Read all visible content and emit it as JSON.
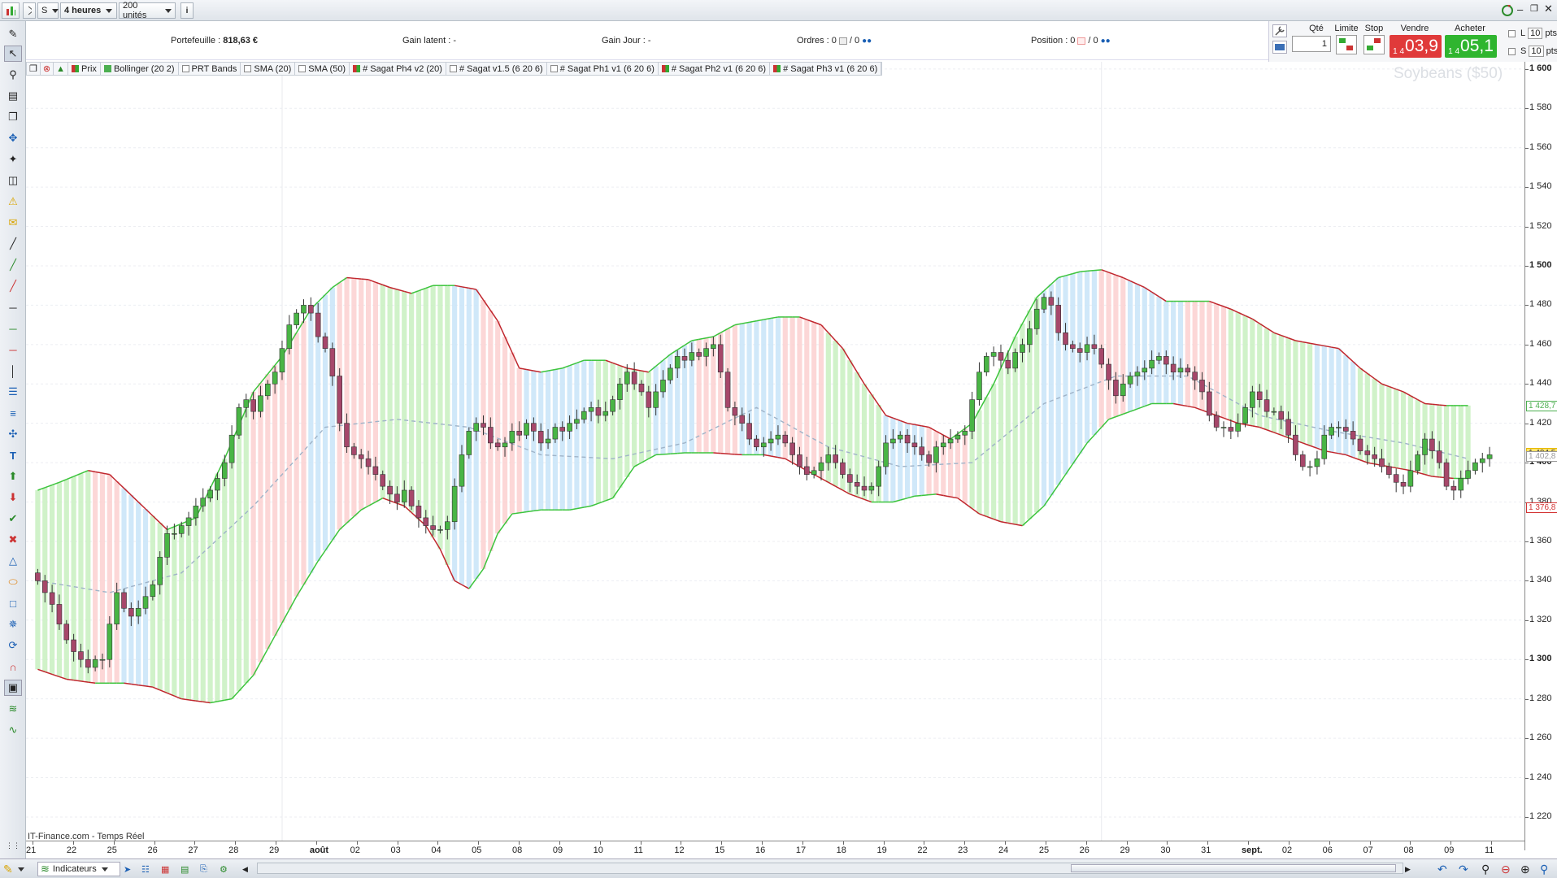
{
  "toolbar": {
    "symbol": "S",
    "timeframe": "4 heures",
    "units": "200 unités",
    "info_icon": "i"
  },
  "info": {
    "portfolio_label": "Portefeuille :",
    "portfolio_value": "818,63 €",
    "latent_label": "Gain latent :",
    "latent_value": "-",
    "day_label": "Gain Jour :",
    "day_value": "-",
    "orders_label": "Ordres :",
    "orders_a": "0",
    "orders_b": "/ 0",
    "position_label": "Position :",
    "position_a": "0",
    "position_b": "/ 0"
  },
  "order": {
    "qty_label": "Qté",
    "qty_value": "1",
    "limit_label": "Limite",
    "stop_label": "Stop",
    "sell_label": "Vendre",
    "buy_label": "Acheter",
    "sell_small": "1 4",
    "sell_big": "03,9",
    "buy_small": "1 4",
    "buy_big": "05,1",
    "l_label": "L",
    "s_label": "S",
    "pts_value": "10",
    "pts_label": "pts"
  },
  "legend": [
    "Prix",
    "Bollinger (20 2)",
    "PRT Bands",
    "SMA (20)",
    "SMA (50)",
    "# Sagat Ph4 v2 (20)",
    "# Sagat v1.5 (6 20 6)",
    "# Sagat Ph1 v1 (6 20 6)",
    "# Sagat Ph2 v1 (6 20 6)",
    "# Sagat Ph3 v1 (6 20 6)"
  ],
  "instrument": "Soybeans ($50)",
  "source": "IT-Finance.com - Temps Réel",
  "bottom": {
    "indicators_label": "Indicateurs"
  },
  "chart_data": {
    "type": "candlestick",
    "y_ticks": [
      "1 600",
      "1 580",
      "1 560",
      "1 540",
      "1 520",
      "1 500",
      "1 480",
      "1 460",
      "1 440",
      "1 420",
      "1 400",
      "1 380",
      "1 360",
      "1 340",
      "1 320",
      "1 300",
      "1 280",
      "1 260",
      "1 240",
      "1 220"
    ],
    "ylim": [
      1208,
      1602
    ],
    "x_ticks": [
      "21",
      "22",
      "25",
      "26",
      "27",
      "28",
      "29",
      "août",
      "02",
      "03",
      "04",
      "05",
      "08",
      "09",
      "10",
      "11",
      "12",
      "15",
      "16",
      "17",
      "18",
      "19",
      "22",
      "23",
      "24",
      "25",
      "26",
      "29",
      "30",
      "31",
      "sept.",
      "02",
      "06",
      "07",
      "08",
      "09",
      "11"
    ],
    "price_labels": [
      {
        "text": "1 428,7",
        "value": 1428.7,
        "color": "#4caf50"
      },
      {
        "text": "1 404,5",
        "value": 1404.5,
        "color": "#e6b800"
      },
      {
        "text": "1 402,8",
        "value": 1402.8,
        "color": "#999999"
      },
      {
        "text": "1 376,8",
        "value": 1376.8,
        "color": "#d33333"
      }
    ],
    "bands": {
      "upper": [
        [
          0,
          1386
        ],
        [
          3,
          1390
        ],
        [
          7,
          1396
        ],
        [
          10,
          1394
        ],
        [
          14,
          1380
        ],
        [
          18,
          1366
        ],
        [
          22,
          1372
        ],
        [
          26,
          1402
        ],
        [
          30,
          1436
        ],
        [
          34,
          1454
        ],
        [
          38,
          1478
        ],
        [
          41,
          1489
        ],
        [
          43,
          1494
        ],
        [
          46,
          1493
        ],
        [
          49,
          1489
        ],
        [
          52,
          1486
        ],
        [
          55,
          1490
        ],
        [
          58,
          1490
        ],
        [
          61,
          1488
        ],
        [
          64,
          1472
        ],
        [
          67,
          1448
        ],
        [
          70,
          1446
        ],
        [
          73,
          1448
        ],
        [
          76,
          1452
        ],
        [
          79,
          1452
        ],
        [
          82,
          1448
        ],
        [
          85,
          1446
        ],
        [
          88,
          1455
        ],
        [
          91,
          1462
        ],
        [
          94,
          1464
        ],
        [
          97,
          1470
        ],
        [
          100,
          1472
        ],
        [
          103,
          1474
        ],
        [
          106,
          1474
        ],
        [
          109,
          1470
        ],
        [
          112,
          1458
        ],
        [
          115,
          1440
        ],
        [
          118,
          1424
        ],
        [
          121,
          1420
        ],
        [
          124,
          1418
        ],
        [
          127,
          1412
        ],
        [
          130,
          1420
        ],
        [
          133,
          1440
        ],
        [
          136,
          1464
        ],
        [
          139,
          1484
        ],
        [
          142,
          1494
        ],
        [
          145,
          1497
        ],
        [
          148,
          1498
        ],
        [
          151,
          1494
        ],
        [
          154,
          1489
        ],
        [
          157,
          1482
        ],
        [
          160,
          1482
        ],
        [
          163,
          1482
        ],
        [
          166,
          1478
        ],
        [
          169,
          1473
        ],
        [
          172,
          1466
        ],
        [
          175,
          1462
        ],
        [
          178,
          1460
        ],
        [
          181,
          1458
        ],
        [
          184,
          1448
        ],
        [
          187,
          1440
        ],
        [
          190,
          1436
        ],
        [
          193,
          1430
        ],
        [
          196,
          1429
        ],
        [
          199,
          1429
        ]
      ],
      "middle": [
        [
          0,
          1340
        ],
        [
          10,
          1334
        ],
        [
          20,
          1344
        ],
        [
          30,
          1378
        ],
        [
          40,
          1418
        ],
        [
          50,
          1422
        ],
        [
          60,
          1418
        ],
        [
          70,
          1404
        ],
        [
          80,
          1402
        ],
        [
          90,
          1410
        ],
        [
          100,
          1428
        ],
        [
          110,
          1408
        ],
        [
          120,
          1398
        ],
        [
          130,
          1400
        ],
        [
          140,
          1430
        ],
        [
          150,
          1444
        ],
        [
          160,
          1444
        ],
        [
          170,
          1424
        ],
        [
          180,
          1416
        ],
        [
          190,
          1410
        ],
        [
          199,
          1402
        ]
      ],
      "lower": [
        [
          0,
          1295
        ],
        [
          4,
          1290
        ],
        [
          8,
          1288
        ],
        [
          12,
          1288
        ],
        [
          16,
          1286
        ],
        [
          20,
          1280
        ],
        [
          24,
          1278
        ],
        [
          27,
          1280
        ],
        [
          30,
          1292
        ],
        [
          33,
          1312
        ],
        [
          36,
          1332
        ],
        [
          39,
          1350
        ],
        [
          42,
          1366
        ],
        [
          45,
          1376
        ],
        [
          48,
          1382
        ],
        [
          51,
          1378
        ],
        [
          54,
          1368
        ],
        [
          56,
          1356
        ],
        [
          58,
          1340
        ],
        [
          60,
          1336
        ],
        [
          62,
          1346
        ],
        [
          64,
          1364
        ],
        [
          66,
          1374
        ],
        [
          70,
          1376
        ],
        [
          74,
          1376
        ],
        [
          77,
          1378
        ],
        [
          80,
          1382
        ],
        [
          83,
          1398
        ],
        [
          86,
          1404
        ],
        [
          90,
          1405
        ],
        [
          94,
          1405
        ],
        [
          98,
          1404
        ],
        [
          101,
          1404
        ],
        [
          104,
          1402
        ],
        [
          107,
          1396
        ],
        [
          110,
          1390
        ],
        [
          113,
          1384
        ],
        [
          116,
          1380
        ],
        [
          119,
          1380
        ],
        [
          122,
          1383
        ],
        [
          125,
          1384
        ],
        [
          128,
          1382
        ],
        [
          131,
          1374
        ],
        [
          134,
          1370
        ],
        [
          137,
          1368
        ],
        [
          140,
          1378
        ],
        [
          143,
          1394
        ],
        [
          146,
          1410
        ],
        [
          149,
          1422
        ],
        [
          152,
          1426
        ],
        [
          155,
          1430
        ],
        [
          158,
          1430
        ],
        [
          161,
          1428
        ],
        [
          164,
          1424
        ],
        [
          167,
          1420
        ],
        [
          170,
          1418
        ],
        [
          173,
          1414
        ],
        [
          176,
          1410
        ],
        [
          179,
          1406
        ],
        [
          182,
          1404
        ],
        [
          185,
          1400
        ],
        [
          188,
          1398
        ],
        [
          191,
          1396
        ],
        [
          194,
          1393
        ],
        [
          197,
          1392
        ],
        [
          199,
          1392
        ]
      ],
      "shade_colors": [
        "#c8f0c0",
        "#fbd0d0",
        "#c8e4f8",
        "#c8f0c0",
        "#fbd0d0",
        "#c8e4f8",
        "#fbd0d0",
        "#c8f0c0",
        "#c8e4f8",
        "#fbd0d0",
        "#c8e4f8",
        "#c8f0c0",
        "#c8e4f8",
        "#fbd0d0",
        "#c8e4f8",
        "#fbd0d0",
        "#c8f0c0",
        "#c8e4f8",
        "#fbd0d0",
        "#c8f0c0",
        "#c8e4f8",
        "#fbd0d0",
        "#c8e4f8",
        "#fbd0d0",
        "#c8f0c0",
        "#c8e4f8",
        "#c8f0c0"
      ],
      "shade_breaks": [
        0,
        8,
        12,
        16,
        30,
        38,
        42,
        48,
        58,
        62,
        68,
        78,
        86,
        92,
        98,
        104,
        110,
        118,
        124,
        130,
        140,
        148,
        152,
        160,
        166,
        178,
        184,
        200
      ]
    },
    "closes": [
      1340,
      1334,
      1328,
      1318,
      1310,
      1304,
      1300,
      1296,
      1300,
      1300,
      1318,
      1334,
      1326,
      1322,
      1326,
      1332,
      1338,
      1352,
      1364,
      1364,
      1368,
      1372,
      1378,
      1382,
      1386,
      1392,
      1400,
      1414,
      1428,
      1432,
      1426,
      1434,
      1440,
      1446,
      1458,
      1470,
      1476,
      1480,
      1476,
      1464,
      1458,
      1444,
      1420,
      1408,
      1404,
      1402,
      1398,
      1394,
      1388,
      1384,
      1380,
      1386,
      1378,
      1372,
      1368,
      1366,
      1366,
      1370,
      1388,
      1404,
      1416,
      1420,
      1418,
      1410,
      1408,
      1410,
      1416,
      1414,
      1420,
      1416,
      1410,
      1412,
      1418,
      1416,
      1420,
      1422,
      1426,
      1428,
      1424,
      1426,
      1432,
      1440,
      1446,
      1440,
      1436,
      1428,
      1436,
      1442,
      1448,
      1454,
      1452,
      1456,
      1454,
      1458,
      1460,
      1446,
      1428,
      1424,
      1420,
      1412,
      1408,
      1410,
      1412,
      1414,
      1410,
      1404,
      1398,
      1394,
      1396,
      1400,
      1404,
      1400,
      1394,
      1390,
      1388,
      1386,
      1388,
      1398,
      1410,
      1412,
      1414,
      1410,
      1408,
      1404,
      1400,
      1408,
      1410,
      1412,
      1414,
      1416,
      1432,
      1446,
      1454,
      1456,
      1452,
      1448,
      1456,
      1460,
      1468,
      1478,
      1484,
      1480,
      1466,
      1460,
      1458,
      1456,
      1460,
      1458,
      1450,
      1442,
      1434,
      1440,
      1444,
      1446,
      1448,
      1452,
      1454,
      1450,
      1446,
      1448,
      1446,
      1442,
      1436,
      1424,
      1418,
      1418,
      1416,
      1420,
      1428,
      1436,
      1432,
      1426,
      1426,
      1422,
      1414,
      1404,
      1398,
      1398,
      1402,
      1414,
      1418,
      1418,
      1416,
      1412,
      1406,
      1404,
      1402,
      1398,
      1394,
      1390,
      1388,
      1396,
      1404,
      1412,
      1406,
      1400,
      1388,
      1386,
      1392,
      1396,
      1400,
      1402,
      1404
    ]
  }
}
